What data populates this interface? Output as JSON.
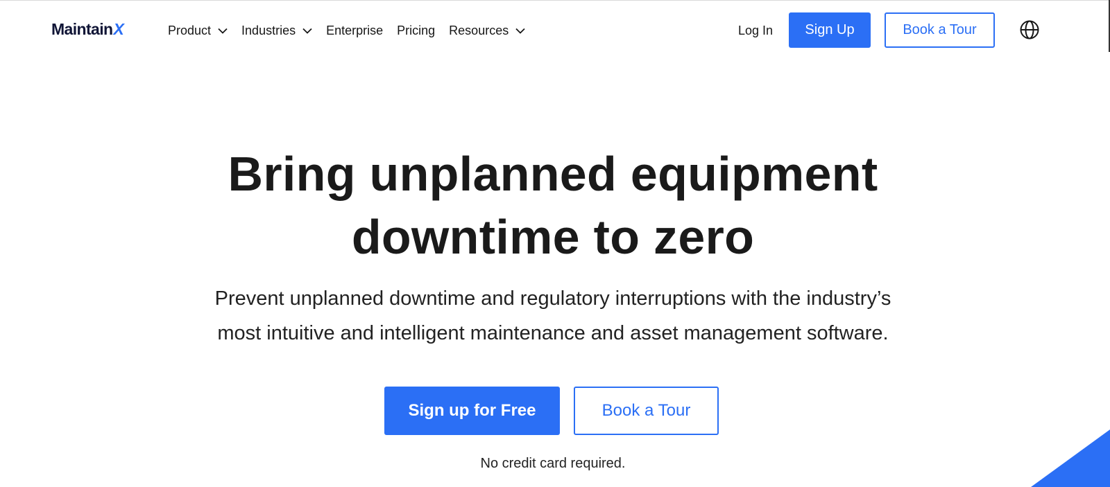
{
  "nav": {
    "logo": {
      "text": "Maintain",
      "x_mark": "X"
    },
    "items": [
      {
        "label": "Product",
        "has_dropdown": true
      },
      {
        "label": "Industries",
        "has_dropdown": true
      },
      {
        "label": "Enterprise",
        "has_dropdown": false
      },
      {
        "label": "Pricing",
        "has_dropdown": false
      },
      {
        "label": "Resources",
        "has_dropdown": true
      }
    ],
    "login_label": "Log In",
    "signup_label": "Sign Up",
    "book_tour_label": "Book a Tour",
    "language_icon": "globe-icon"
  },
  "hero": {
    "title_line1": "Bring unplanned equipment",
    "title_line2": "downtime to zero",
    "subtitle_line1": "Prevent unplanned downtime and regulatory interruptions with the industry’s",
    "subtitle_line2": "most intuitive and intelligent maintenance and asset management software.",
    "primary_cta": "Sign up for Free",
    "secondary_cta": "Book a Tour",
    "note": "No credit card required."
  },
  "colors": {
    "brand_blue": "#2b6ff5",
    "logo_dark": "#101536",
    "text": "#1a1a1a",
    "background": "#ffffff"
  }
}
